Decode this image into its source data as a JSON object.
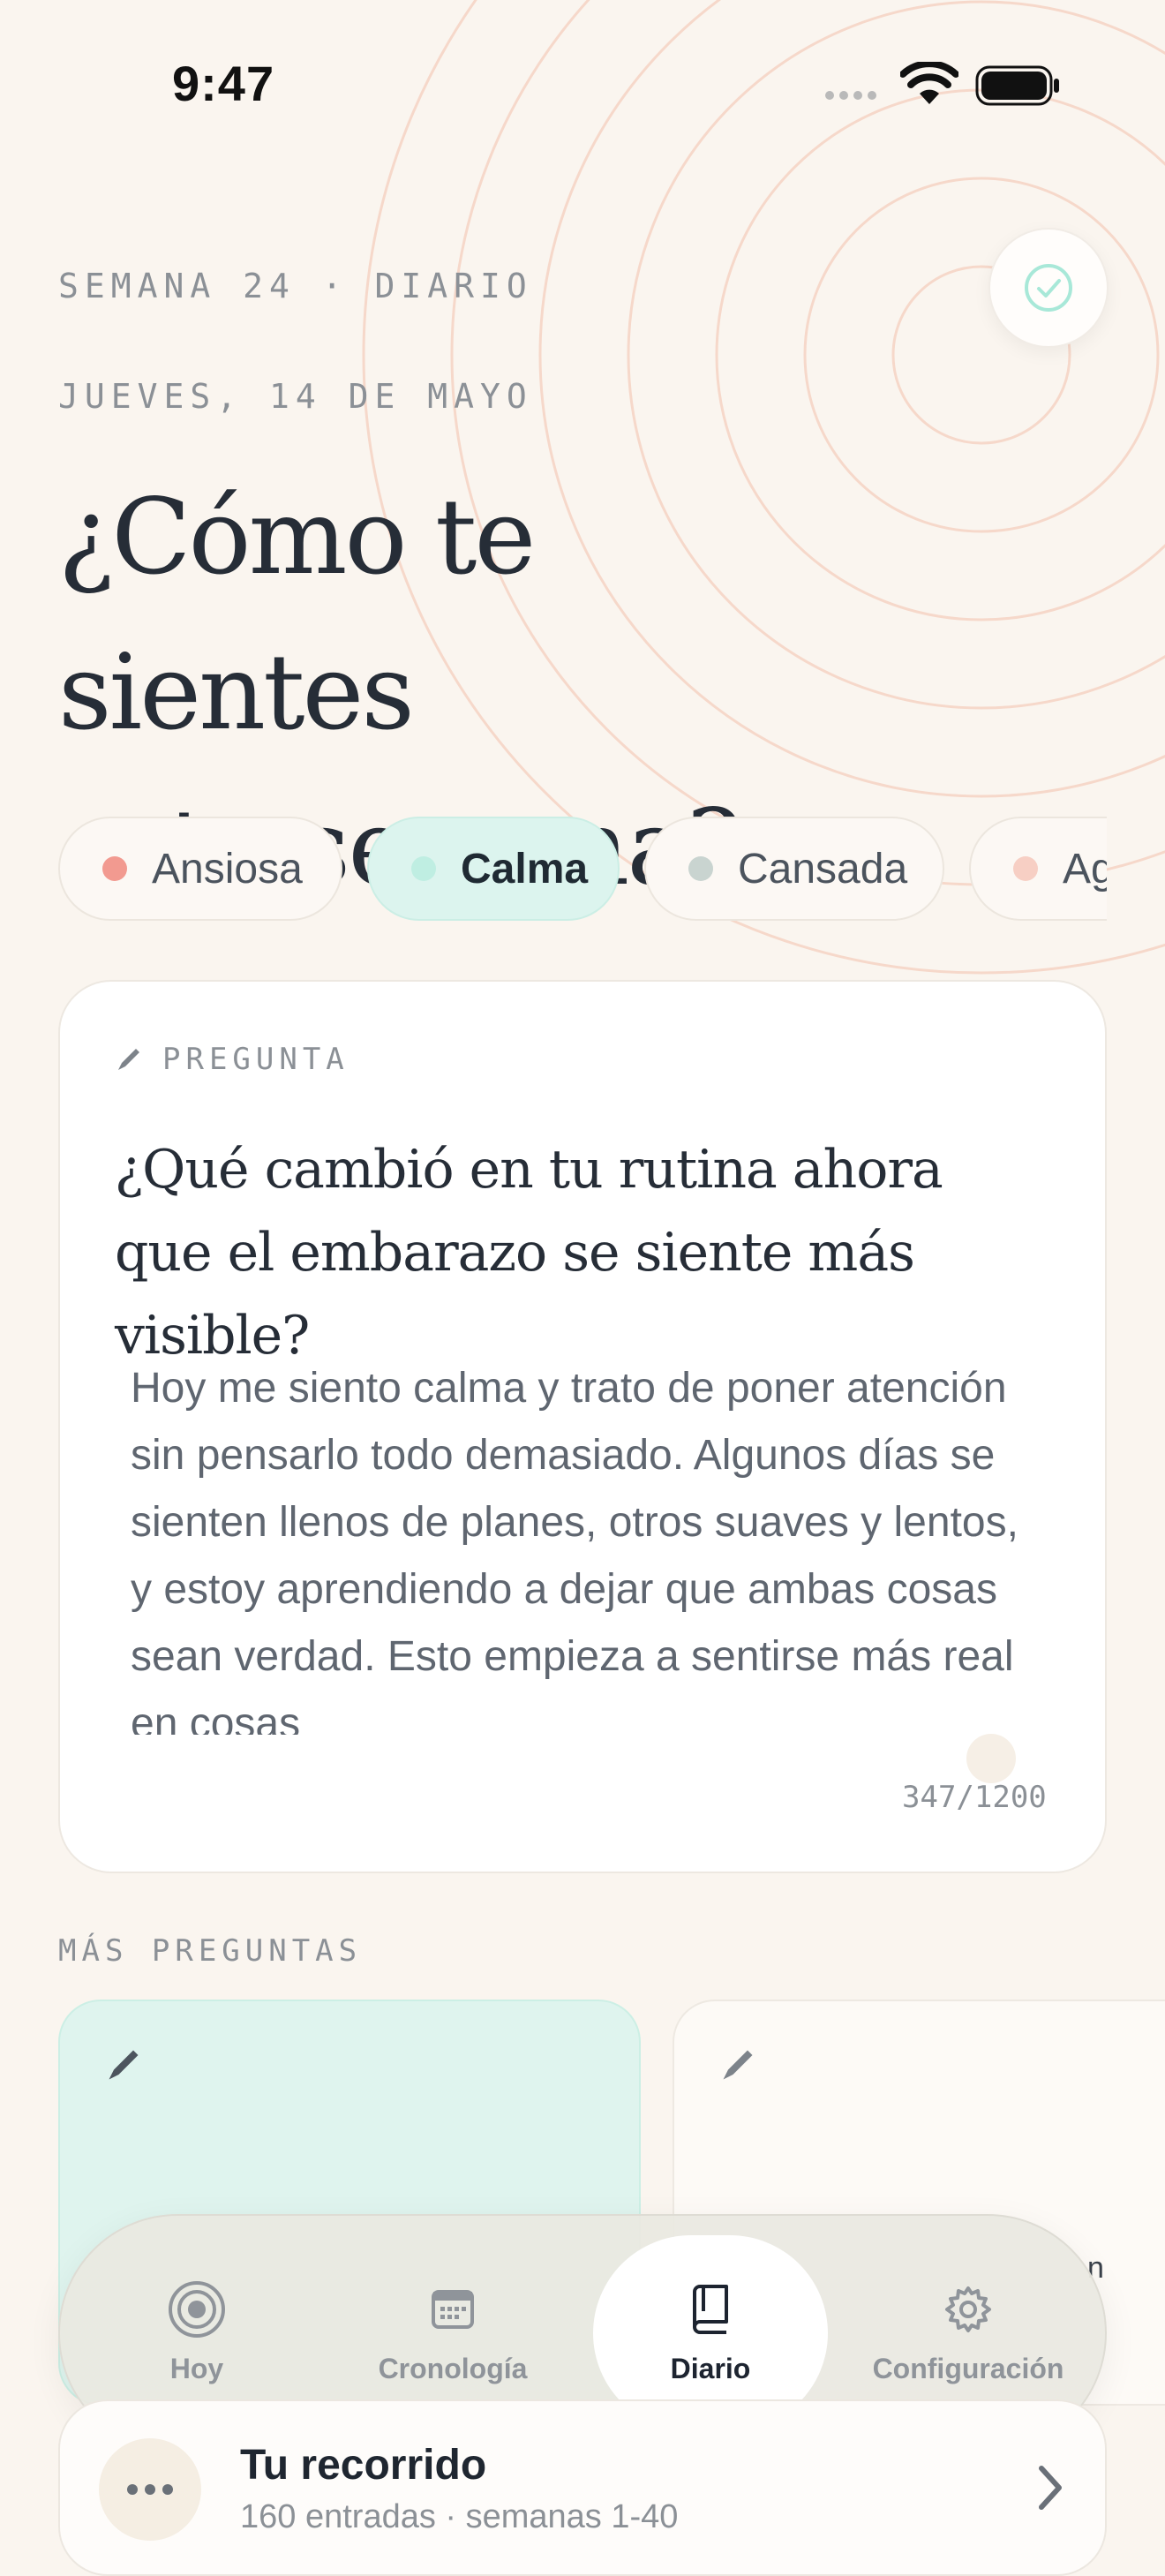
{
  "status_bar": {
    "time": "9:47"
  },
  "header": {
    "week_label": "SEMANA 24 · DIARIO",
    "date_label": "JUEVES, 14 DE MAYO",
    "title_line1": "¿Cómo te sientes",
    "title_line2": "esta semana?"
  },
  "moods": [
    {
      "label": "Ansiosa",
      "color": "#f29a90",
      "selected": false
    },
    {
      "label": "Calma",
      "color": "#bfeee2",
      "selected": true
    },
    {
      "label": "Cansada",
      "color": "#c9d4d0",
      "selected": false
    },
    {
      "label": "Ag",
      "color": "#f7cfc4",
      "selected": false
    }
  ],
  "question_card": {
    "label": "PREGUNTA",
    "question": "¿Qué cambió en tu rutina ahora que el embarazo se siente más visible?",
    "answer": "Hoy me siento calma y trato de poner atención sin pensarlo todo demasiado. Algunos días se sienten llenos de planes, otros suaves y lentos, y estoy aprendiendo a dejar que ambas cosas sean verdad. Esto empieza a sentirse más real en cosas",
    "counter": "347/1200"
  },
  "more_questions": {
    "label": "MÁS PREGUNTAS",
    "peek_text": "n"
  },
  "tabbar": {
    "tabs": [
      {
        "label": "Hoy",
        "icon": "target-icon"
      },
      {
        "label": "Cronología",
        "icon": "calendar-icon"
      },
      {
        "label": "Diario",
        "icon": "book-icon"
      },
      {
        "label": "Configuración",
        "icon": "gear-icon"
      }
    ],
    "active": "Diario"
  },
  "journey": {
    "title": "Tu recorrido",
    "subtitle": "160 entradas · semanas 1-40"
  },
  "colors": {
    "background": "#faf5ef",
    "accent_mint": "#dcf4ee",
    "ring": "#f6d5c6"
  }
}
